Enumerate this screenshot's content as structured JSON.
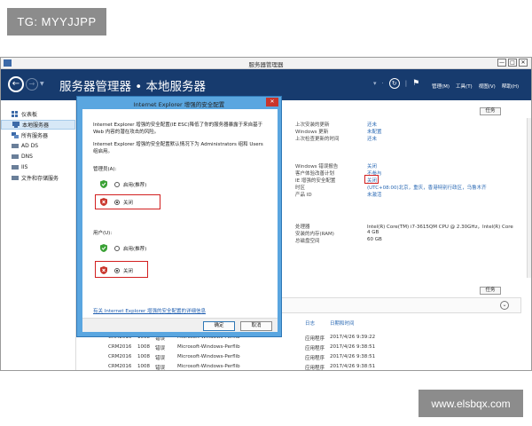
{
  "watermarks": {
    "tg": "TG: MYYJJPP",
    "url": "www.elsbqx.com"
  },
  "window": {
    "title": "服务器管理器",
    "controls": {
      "minimize": "—",
      "restore": "□",
      "close": "✕"
    }
  },
  "header": {
    "breadcrumb": "服务器管理器 • 本地服务器",
    "menu": [
      "管理(M)",
      "工具(T)",
      "视图(V)",
      "帮助(H)"
    ]
  },
  "sidebar": {
    "items": [
      {
        "label": "仪表板",
        "icon": "dashboard-icon"
      },
      {
        "label": "本地服务器",
        "icon": "server-icon",
        "selected": true
      },
      {
        "label": "所有服务器",
        "icon": "servers-icon"
      },
      {
        "label": "AD DS",
        "icon": "ad-ds-icon"
      },
      {
        "label": "DNS",
        "icon": "dns-icon"
      },
      {
        "label": "IIS",
        "icon": "iis-icon"
      },
      {
        "label": "文件和存储服务",
        "icon": "storage-icon"
      }
    ]
  },
  "content": {
    "task_label": "任务",
    "updates": [
      {
        "label": "上次安装的更新",
        "value": "还未"
      },
      {
        "label": "Windows 更新",
        "value": "未配置"
      },
      {
        "label": "上次检查更新的时间",
        "value": "还未"
      }
    ],
    "security": [
      {
        "label": "Windows 错误报告",
        "value": "关闭"
      },
      {
        "label": "客户体验改善计划",
        "value": "不参与"
      },
      {
        "label": "IE 增强的安全配置",
        "value": "关闭"
      },
      {
        "label": "时区",
        "value": "(UTC+08:00)北京，重庆，香港特别行政区，乌鲁木齐"
      },
      {
        "label": "产品 ID",
        "value": "未激活"
      }
    ],
    "hardware": [
      {
        "label": "处理器",
        "value": "Intel(R) Core(TM) i7-3615QM CPU @ 2.30GHz，Intel(R) Core"
      },
      {
        "label": "安装的内存(RAM)",
        "value": "4 GB"
      },
      {
        "label": "总磁盘空间",
        "value": "60 GB"
      }
    ],
    "event_headers": {
      "log": "日志",
      "datetime": "日期和时间"
    },
    "events": [
      {
        "server": "CRM2016",
        "id": "1008",
        "level": "错误",
        "source": "Microsoft-Windows-Perflib",
        "log": "应用程序",
        "time": "2017/4/26 9:39:22"
      },
      {
        "server": "CRM2016",
        "id": "1008",
        "level": "错误",
        "source": "Microsoft-Windows-Perflib",
        "log": "应用程序",
        "time": "2017/4/26 9:38:51"
      },
      {
        "server": "CRM2016",
        "id": "1008",
        "level": "错误",
        "source": "Microsoft-Windows-Perflib",
        "log": "应用程序",
        "time": "2017/4/26 9:38:51"
      },
      {
        "server": "CRM2016",
        "id": "1008",
        "level": "错误",
        "source": "Microsoft-Windows-Perflib",
        "log": "应用程序",
        "time": "2017/4/26 9:38:51"
      }
    ]
  },
  "dialog": {
    "title": "Internet Explorer 增强的安全配置",
    "close": "✕",
    "paragraph1": "Internet Explorer 增强的安全配置(IE ESC)降低了你的服务器暴露于来自基于 Web 内容的潜在攻击的风险。",
    "paragraph2": "Internet Explorer 增强的安全配置默认情况下为 Administrators 组和 Users 组启用。",
    "admin_label": "管理员(A):",
    "user_label": "用户(U):",
    "option_on": "启用(推荐)",
    "option_off": "关闭",
    "link": "有关 Internet Explorer 增强的安全配置的详细信息",
    "ok": "确定",
    "cancel": "取消"
  }
}
